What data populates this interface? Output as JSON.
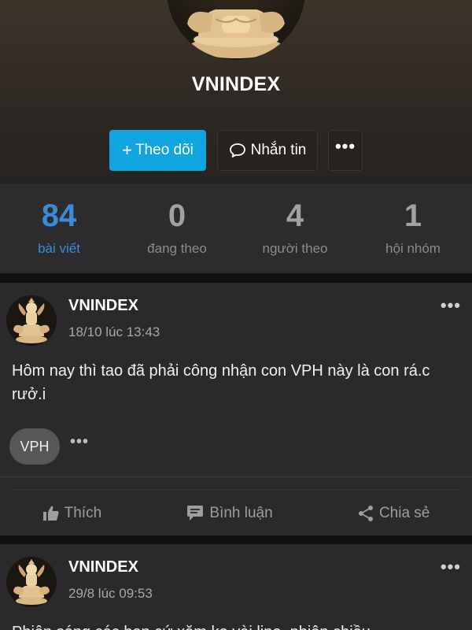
{
  "profile": {
    "name": "VNINDEX",
    "follow_label": "Theo dõi",
    "message_label": "Nhắn tin",
    "more_label": "•••"
  },
  "stats": [
    {
      "value": "84",
      "label": "bài viết",
      "active": true
    },
    {
      "value": "0",
      "label": "đang theo",
      "active": false
    },
    {
      "value": "4",
      "label": "người theo",
      "active": false
    },
    {
      "value": "1",
      "label": "hội nhóm",
      "active": false
    }
  ],
  "posts": [
    {
      "author": "VNINDEX",
      "time": "18/10 lúc 13:43",
      "content": "Hôm nay thì tao đã phải công nhận con VPH này là con rá.c rưở.i",
      "tag": "VPH",
      "tag_more": "•••",
      "menu": "•••"
    },
    {
      "author": "VNINDEX",
      "time": "29/8 lúc 09:53",
      "content": "Phiên sáng các bạn cứ xăm ke vài line, phiên chiều",
      "menu": "•••"
    }
  ],
  "actions": {
    "like": "Thích",
    "comment": "Bình luận",
    "share": "Chia sẻ"
  },
  "colors": {
    "accent": "#10a5de",
    "stat_active": "#3b8bd8",
    "card": "#2a2a2c",
    "background": "#141416"
  },
  "icons": [
    "plus-icon",
    "chat-bubble-icon",
    "more-dots-icon",
    "thumbs-up-icon",
    "comment-icon",
    "share-icon",
    "buddha-avatar-icon"
  ]
}
